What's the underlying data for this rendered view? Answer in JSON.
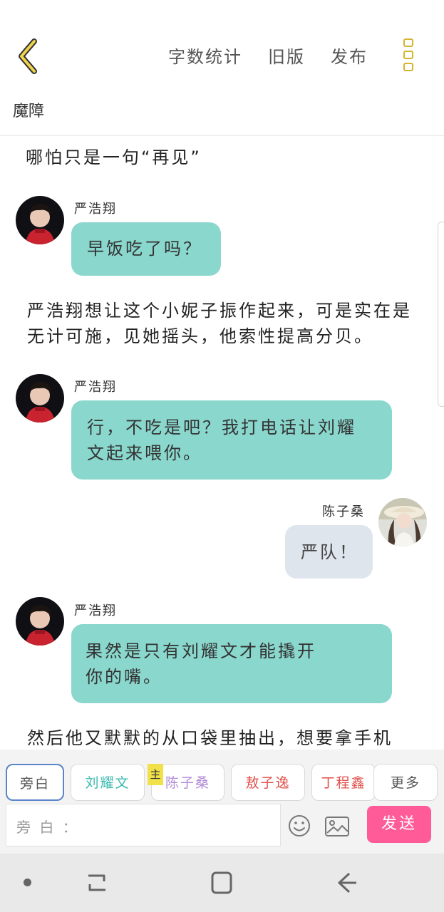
{
  "header": {
    "actions": [
      "字数统计",
      "旧版",
      "发布"
    ],
    "title": "魔障"
  },
  "content": {
    "narration_1": "哪怕只是一句“再见”",
    "msg_1": {
      "speaker": "严浩翔",
      "text": "早饭吃了吗？"
    },
    "narration_2": "严浩翔想让这个小妮子振作起来，可是实在是无计可施，见她摇头，他索性提高分贝。",
    "msg_2": {
      "speaker": "严浩翔",
      "text": "行，不吃是吧？我打电话让刘耀文起来喂你。"
    },
    "msg_3": {
      "speaker": "陈子桑",
      "text": "严队！"
    },
    "msg_4": {
      "speaker": "严浩翔",
      "text": "果然是只有刘耀文才能撬开你的嘴。"
    },
    "narration_3": "然后他又默默的从口袋里抽出，想要拿手机"
  },
  "composer": {
    "roles": [
      {
        "label": "旁白",
        "color": "#555555"
      },
      {
        "label": "刘耀文",
        "color": "#3bb9b0"
      },
      {
        "label": "陈子桑",
        "color": "#b08bd6"
      },
      {
        "label": "敖子逸",
        "color": "#e0504a"
      },
      {
        "label": "丁程鑫",
        "color": "#e0504a"
      },
      {
        "label": "更多",
        "color": "#555555"
      }
    ],
    "main_badge": "主",
    "input_placeholder": "旁 白 ：",
    "send_label": "发送"
  },
  "colors": {
    "accent_yellow": "#d3b52f",
    "bubble_teal": "#8ad7cd",
    "bubble_grey": "#dfe5ec",
    "send_pink": "#ff5b98"
  },
  "icons": [
    "back-chevron-icon",
    "more-vertical-icon",
    "emoji-icon",
    "image-icon",
    "nav-dot-icon",
    "nav-recent-icon",
    "nav-home-icon",
    "nav-back-icon"
  ]
}
